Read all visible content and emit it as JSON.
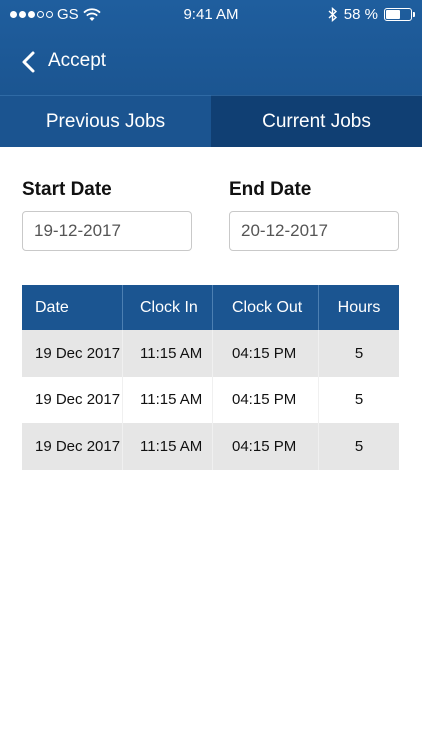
{
  "status_bar": {
    "carrier": "GS",
    "time": "9:41 AM",
    "battery_text": "58 %",
    "battery_level": 0.58,
    "icons": [
      "signal-dots-icon",
      "wifi-icon",
      "bluetooth-icon",
      "battery-icon"
    ]
  },
  "nav": {
    "back_icon": "chevron-left-icon",
    "title": "Accept"
  },
  "tabs": [
    {
      "label": "Previous Jobs",
      "selected": false
    },
    {
      "label": "Current Jobs",
      "selected": true
    }
  ],
  "filters": {
    "start_label": "Start Date",
    "start_value": "19-12-2017",
    "end_label": "End Date",
    "end_value": "20-12-2017"
  },
  "table": {
    "headers": [
      "Date",
      "Clock In",
      "Clock Out",
      "Hours"
    ],
    "rows": [
      [
        "19 Dec 2017",
        "11:15 AM",
        "04:15 PM",
        "5"
      ],
      [
        "19 Dec 2017",
        "11:15 AM",
        "04:15 PM",
        "5"
      ],
      [
        "19 Dec 2017",
        "11:15 AM",
        "04:15 PM",
        "5"
      ]
    ]
  },
  "colors": {
    "primary": "#1b5591",
    "tab_selected": "#103f73",
    "row_shade": "#e6e6e6"
  }
}
